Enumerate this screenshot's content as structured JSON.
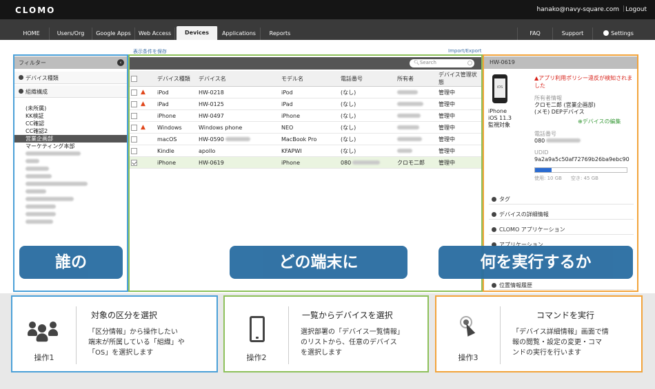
{
  "app": {
    "logo": "CLOMO",
    "user_email": "hanako@navy-square.com",
    "separator": "|",
    "logout": "Logout"
  },
  "nav": {
    "tabs": [
      {
        "label": "HOME"
      },
      {
        "label": "Users/Org"
      },
      {
        "label": "Google Apps"
      },
      {
        "label": "Web Access"
      },
      {
        "label": "Devices"
      },
      {
        "label": "Applications"
      },
      {
        "label": "Reports"
      }
    ],
    "right": [
      {
        "label": "FAQ"
      },
      {
        "label": "Support"
      },
      {
        "label": "Settings"
      }
    ]
  },
  "links": {
    "save_view": "表示条件を保存",
    "import_export": "Import/Export"
  },
  "filter": {
    "title": "フィルター",
    "sections": [
      {
        "label": "デバイス種類"
      },
      {
        "label": "組織構成"
      }
    ],
    "items": [
      {
        "label": "(未所属)"
      },
      {
        "label": "KK検証"
      },
      {
        "label": "CC確認"
      },
      {
        "label": "CC確認2"
      },
      {
        "label": "営業企画部"
      },
      {
        "label": "マーケティング本部"
      }
    ]
  },
  "devices": {
    "search_placeholder": "Search",
    "columns": [
      "デバイス種類",
      "デバイス名",
      "モデル名",
      "電話番号",
      "所有者",
      "デバイス管理状態"
    ],
    "rows": [
      {
        "type": "iPod",
        "name": "HW-0218",
        "model": "iPod",
        "phone": "(なし)",
        "status": "管理中",
        "warn": "▲",
        "checked": ""
      },
      {
        "type": "iPad",
        "name": "HW-0125",
        "model": "iPad",
        "phone": "(なし)",
        "status": "管理中",
        "warn": "▲",
        "checked": ""
      },
      {
        "type": "iPhone",
        "name": "HW-0497",
        "model": "iPhone",
        "phone": "(なし)",
        "status": "管理中",
        "warn": "",
        "checked": ""
      },
      {
        "type": "Windows",
        "name": "Windows phone",
        "model": "NEO",
        "phone": "(なし)",
        "status": "管理中",
        "warn": "▲",
        "checked": ""
      },
      {
        "type": "macOS",
        "name": "HW-0590",
        "model": "MacBook Pro",
        "phone": "(なし)",
        "status": "管理中",
        "warn": "",
        "checked": ""
      },
      {
        "type": "Kindle",
        "name": "apollo",
        "model": "KFAPWI",
        "phone": "(なし)",
        "status": "管理中",
        "warn": "",
        "checked": ""
      },
      {
        "type": "iPhone",
        "name": "HW-0619",
        "model": "iPhone",
        "phone": "080",
        "owner": "クロモ二郎",
        "status": "管理中",
        "warn": "",
        "checked": "yes"
      }
    ]
  },
  "detail": {
    "title": "HW-0619",
    "phone_icon_label": "iOS",
    "alert": "▲アプリ利用ポリシー違反が検知されました",
    "device_os": "iPhone",
    "os_version": "iOS 11.3",
    "supervised": "監視対象",
    "owner_label": "所有者情報",
    "owner": "クロモ二郎 (営業企画部)",
    "memo": "(メモ)  DEPデバイス",
    "edit_link": "⊕デバイスの編集",
    "phone_label": "電話番号",
    "phone": "080",
    "udid_label": "UDID",
    "udid": "9a2a9a5c50af72769b26ba9ebc90",
    "storage_used": "使用: 10 GB",
    "storage_free": "空き: 45 GB",
    "storage_used_fraction": 0.18,
    "sections": [
      {
        "label": "タグ"
      },
      {
        "label": "デバイスの詳細情報"
      },
      {
        "label": "CLOMO アプリケーション"
      },
      {
        "label": "アプリケーション"
      },
      {
        "label": "位置情報履歴"
      }
    ]
  },
  "banners": {
    "who": "誰の",
    "which": "どの端末に",
    "what": "何を実行するか"
  },
  "steps": [
    {
      "op": "操作1",
      "title": "対象の区分を選択",
      "desc": [
        "「区分情報」から操作したい",
        "端末が所属している「組織」や",
        "「OS」を選択します"
      ]
    },
    {
      "op": "操作2",
      "title": "一覧からデバイスを選択",
      "desc": [
        "選択部署の「デバイス一覧情報」",
        "のリストから、任意のデバイス",
        "を選択します"
      ]
    },
    {
      "op": "操作3",
      "title": "コマンドを実行",
      "desc": [
        "「デバイス詳細情報」画面で情",
        "報の閲覧・設定の変更・コマ",
        "ンドの実行を行います"
      ]
    }
  ],
  "colors": {
    "blue": "#4aa0d8",
    "green": "#8dc05a",
    "orange": "#f2a33a",
    "banner": "#2b6ea2",
    "warning": "#e0461a"
  }
}
